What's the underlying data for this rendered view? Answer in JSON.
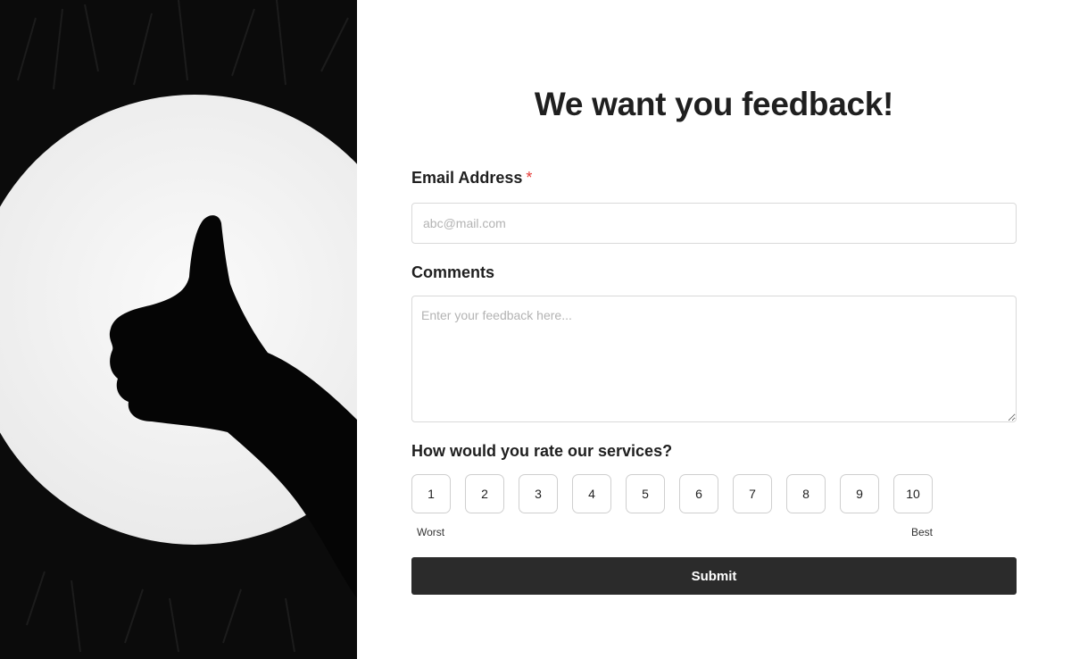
{
  "form": {
    "title": "We want you feedback!",
    "email": {
      "label": "Email Address",
      "required_mark": "*",
      "placeholder": "abc@mail.com",
      "value": ""
    },
    "comments": {
      "label": "Comments",
      "placeholder": "Enter your feedback here...",
      "value": ""
    },
    "rating": {
      "question": "How would you rate our services?",
      "options": [
        "1",
        "2",
        "3",
        "4",
        "5",
        "6",
        "7",
        "8",
        "9",
        "10"
      ],
      "low_label": "Worst",
      "high_label": "Best"
    },
    "submit_label": "Submit"
  },
  "colors": {
    "accent_dark": "#2b2b2b",
    "required": "#e53935",
    "hero_background": "#0b0b0b",
    "hero_disc": "#f3f3f3"
  }
}
